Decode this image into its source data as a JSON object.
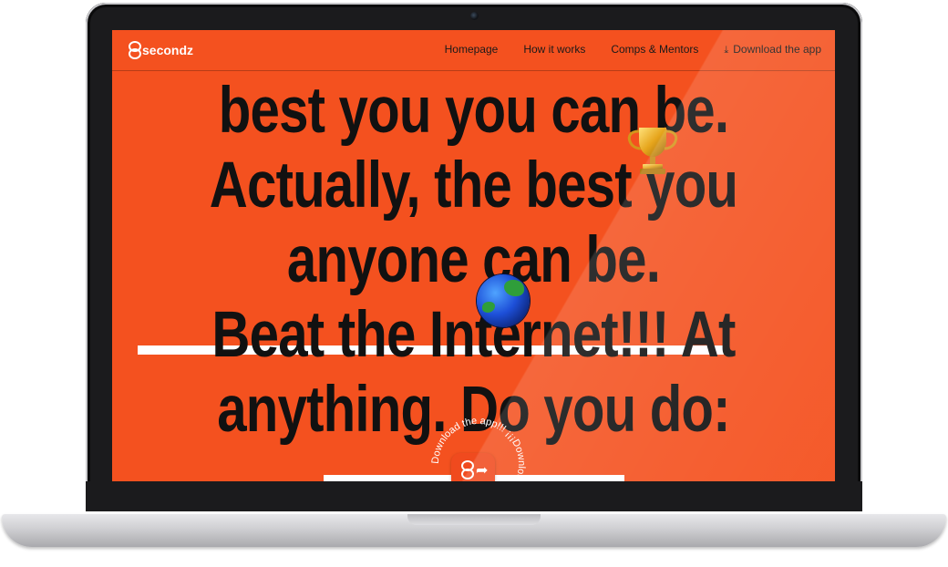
{
  "site": {
    "logo_text": "secondz",
    "nav": {
      "home": "Homepage",
      "how": "How it works",
      "comps": "Comps & Mentors",
      "download": "Download the app"
    }
  },
  "hero": {
    "lines": [
      "best you you can be.",
      "Actually, the best you",
      "anyone can be.",
      "Beat the Internet!!! At",
      "anything. Do you do:"
    ]
  },
  "badge": {
    "ring_text": "Download the app!!!  ¡¡¡Download the app"
  },
  "icons": {
    "download": "download-icon",
    "trophy": "trophy-icon",
    "globe": "globe-icon",
    "share": "share-arrow-icon",
    "logo": "8-infinity-icon"
  },
  "colors": {
    "brand": "#f4511f",
    "text": "#111111",
    "white": "#ffffff"
  }
}
